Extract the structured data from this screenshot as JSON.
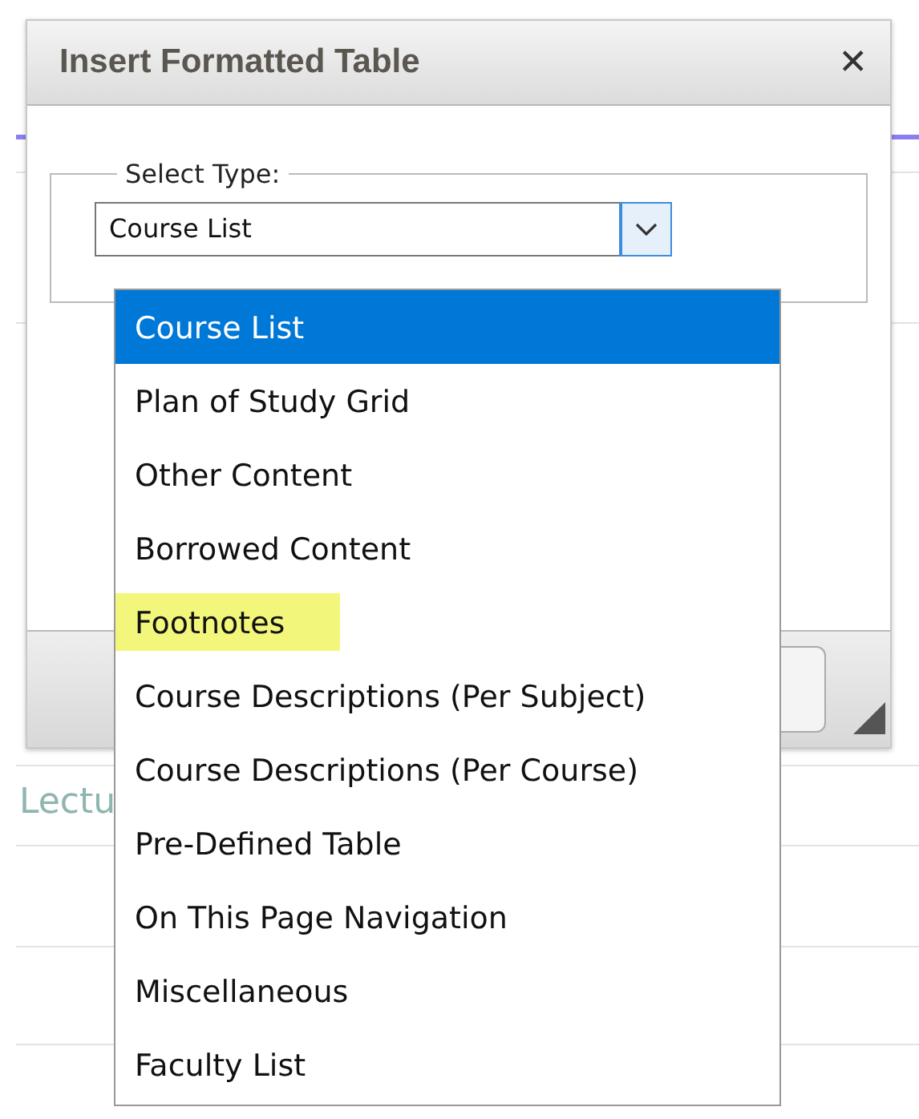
{
  "background": {
    "link_text": "Lectu"
  },
  "dialog": {
    "title": "Insert Formatted Table",
    "close": "✕",
    "fieldset": {
      "legend": "Select Type:",
      "select": {
        "value": "Course List",
        "expanded": true
      }
    }
  },
  "dropdown": {
    "options": [
      {
        "label": "Course List",
        "selected": true,
        "highlighted": false
      },
      {
        "label": "Plan of Study Grid",
        "selected": false,
        "highlighted": false
      },
      {
        "label": "Other Content",
        "selected": false,
        "highlighted": false
      },
      {
        "label": "Borrowed Content",
        "selected": false,
        "highlighted": false
      },
      {
        "label": "Footnotes",
        "selected": false,
        "highlighted": true
      },
      {
        "label": "Course Descriptions (Per Subject)",
        "selected": false,
        "highlighted": false
      },
      {
        "label": "Course Descriptions (Per Course)",
        "selected": false,
        "highlighted": false
      },
      {
        "label": "Pre-Defined Table",
        "selected": false,
        "highlighted": false
      },
      {
        "label": "On This Page Navigation",
        "selected": false,
        "highlighted": false
      },
      {
        "label": "Miscellaneous",
        "selected": false,
        "highlighted": false
      },
      {
        "label": "Faculty List",
        "selected": false,
        "highlighted": false
      }
    ]
  }
}
